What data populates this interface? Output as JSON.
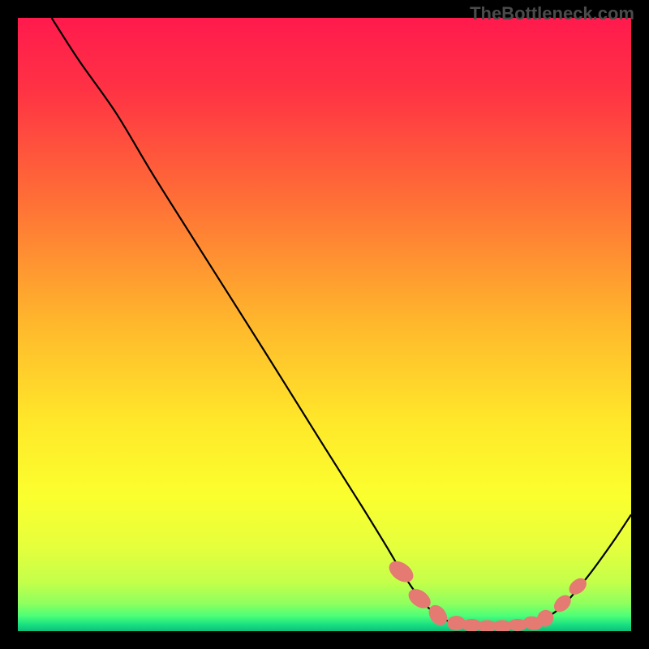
{
  "attribution": "TheBottleneck.com",
  "chart_data": {
    "type": "line",
    "title": "",
    "xlabel": "",
    "ylabel": "",
    "xlim": [
      0,
      100
    ],
    "ylim": [
      0,
      100
    ],
    "background_gradient": {
      "stops": [
        {
          "offset": 0.0,
          "color": "#ff1a4d"
        },
        {
          "offset": 0.12,
          "color": "#ff3344"
        },
        {
          "offset": 0.3,
          "color": "#ff7036"
        },
        {
          "offset": 0.5,
          "color": "#ffb82c"
        },
        {
          "offset": 0.66,
          "color": "#ffe82a"
        },
        {
          "offset": 0.78,
          "color": "#fbff2e"
        },
        {
          "offset": 0.86,
          "color": "#e6ff3c"
        },
        {
          "offset": 0.92,
          "color": "#c4ff4a"
        },
        {
          "offset": 0.955,
          "color": "#8fff5e"
        },
        {
          "offset": 0.975,
          "color": "#4dff78"
        },
        {
          "offset": 0.99,
          "color": "#17de82"
        },
        {
          "offset": 1.0,
          "color": "#0fbf7a"
        }
      ]
    },
    "series": [
      {
        "name": "curve",
        "color": "#000000",
        "points": [
          {
            "x": 5.5,
            "y": 100.0
          },
          {
            "x": 10.0,
            "y": 93.0
          },
          {
            "x": 16.0,
            "y": 84.5
          },
          {
            "x": 22.0,
            "y": 74.5
          },
          {
            "x": 30.0,
            "y": 61.8
          },
          {
            "x": 40.0,
            "y": 46.0
          },
          {
            "x": 50.0,
            "y": 30.0
          },
          {
            "x": 56.0,
            "y": 20.5
          },
          {
            "x": 60.0,
            "y": 14.0
          },
          {
            "x": 63.0,
            "y": 9.0
          },
          {
            "x": 66.0,
            "y": 4.8
          },
          {
            "x": 69.0,
            "y": 2.2
          },
          {
            "x": 72.0,
            "y": 1.1
          },
          {
            "x": 76.0,
            "y": 0.7
          },
          {
            "x": 80.0,
            "y": 0.8
          },
          {
            "x": 84.0,
            "y": 1.3
          },
          {
            "x": 86.0,
            "y": 2.1
          },
          {
            "x": 89.0,
            "y": 4.3
          },
          {
            "x": 93.0,
            "y": 9.0
          },
          {
            "x": 97.0,
            "y": 14.5
          },
          {
            "x": 100.0,
            "y": 19.0
          }
        ]
      }
    ],
    "markers": {
      "color": "#e47a72",
      "points": [
        {
          "x": 62.5,
          "y": 9.7,
          "rx": 1.4,
          "ry": 2.2,
          "angle": -55
        },
        {
          "x": 65.5,
          "y": 5.3,
          "rx": 1.3,
          "ry": 2.0,
          "angle": -55
        },
        {
          "x": 68.5,
          "y": 2.6,
          "rx": 1.3,
          "ry": 1.8,
          "angle": -35
        },
        {
          "x": 71.5,
          "y": 1.3,
          "rx": 1.5,
          "ry": 1.2,
          "angle": 0
        },
        {
          "x": 74.0,
          "y": 0.95,
          "rx": 1.6,
          "ry": 1.05,
          "angle": 0
        },
        {
          "x": 76.5,
          "y": 0.8,
          "rx": 1.6,
          "ry": 1.0,
          "angle": 0
        },
        {
          "x": 79.0,
          "y": 0.8,
          "rx": 1.6,
          "ry": 1.0,
          "angle": 0
        },
        {
          "x": 81.5,
          "y": 1.0,
          "rx": 1.6,
          "ry": 1.0,
          "angle": 0
        },
        {
          "x": 84.0,
          "y": 1.3,
          "rx": 1.6,
          "ry": 1.1,
          "angle": 10
        },
        {
          "x": 86.0,
          "y": 2.1,
          "rx": 1.3,
          "ry": 1.4,
          "angle": 35
        },
        {
          "x": 88.8,
          "y": 4.5,
          "rx": 1.1,
          "ry": 1.6,
          "angle": 45
        },
        {
          "x": 91.3,
          "y": 7.3,
          "rx": 1.1,
          "ry": 1.6,
          "angle": 50
        }
      ]
    }
  }
}
